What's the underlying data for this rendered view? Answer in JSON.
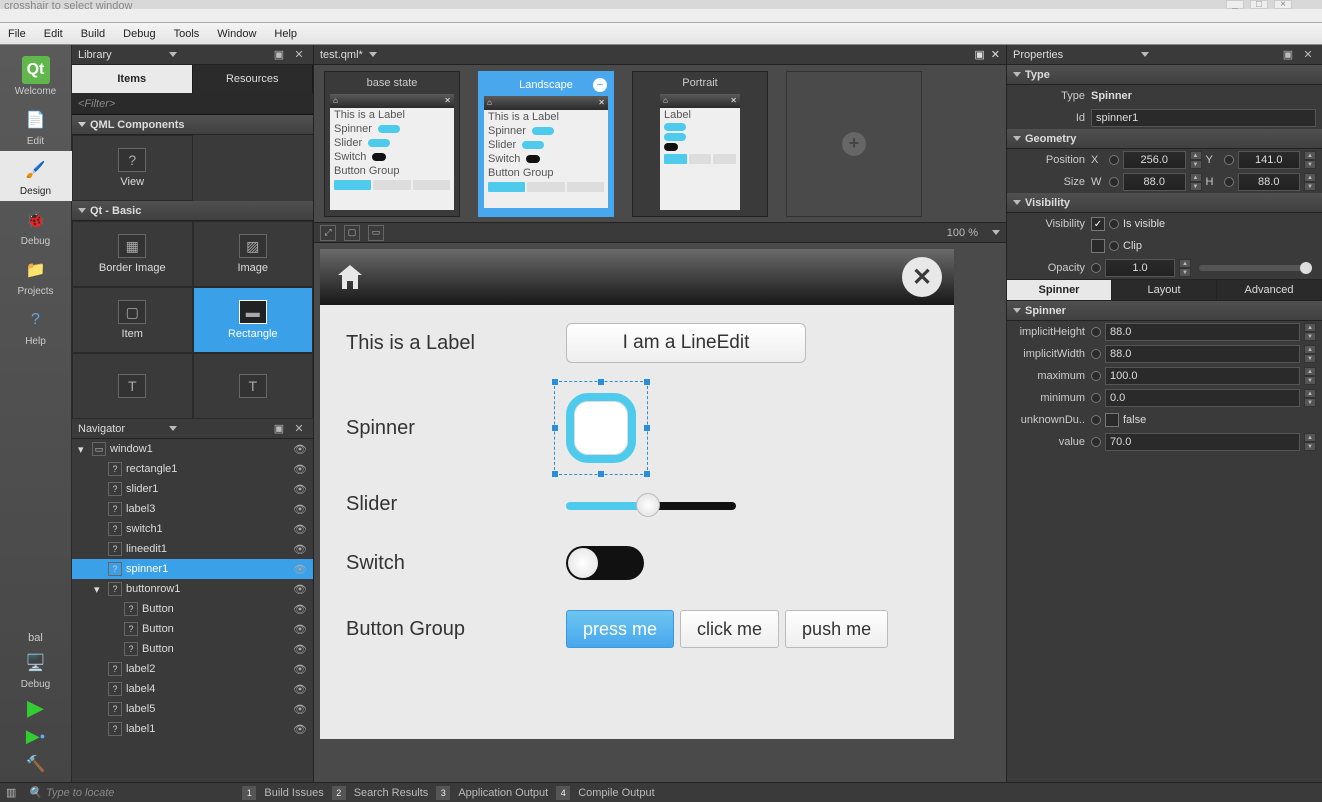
{
  "topcrop": "crosshair to select window",
  "menu": [
    "File",
    "Edit",
    "Build",
    "Debug",
    "Tools",
    "Window",
    "Help"
  ],
  "modes": [
    {
      "label": "Welcome",
      "iconColor": "#62b74c"
    },
    {
      "label": "Edit"
    },
    {
      "label": "Design",
      "active": true
    },
    {
      "label": "Debug"
    },
    {
      "label": "Projects"
    },
    {
      "label": "Help"
    }
  ],
  "bottomLabel": "bal",
  "bottomDebug": "Debug",
  "leftpanel": {
    "libraryTitle": "Library",
    "tabs": [
      "Items",
      "Resources"
    ],
    "filterPlaceholder": "<Filter>",
    "section1": "QML Components",
    "section1Item": "View",
    "section2": "Qt - Basic",
    "items": [
      {
        "label": "Border Image"
      },
      {
        "label": "Image"
      },
      {
        "label": "Item"
      },
      {
        "label": "Rectangle",
        "selected": true
      }
    ],
    "navigatorTitle": "Navigator",
    "tree": [
      {
        "label": "window1",
        "depth": 0,
        "expand": "▾"
      },
      {
        "label": "rectangle1",
        "depth": 1
      },
      {
        "label": "slider1",
        "depth": 1
      },
      {
        "label": "label3",
        "depth": 1
      },
      {
        "label": "switch1",
        "depth": 1
      },
      {
        "label": "lineedit1",
        "depth": 1
      },
      {
        "label": "spinner1",
        "depth": 1,
        "selected": true
      },
      {
        "label": "buttonrow1",
        "depth": 1,
        "expand": "▾"
      },
      {
        "label": "Button",
        "depth": 2
      },
      {
        "label": "Button",
        "depth": 2
      },
      {
        "label": "Button",
        "depth": 2
      },
      {
        "label": "label2",
        "depth": 1
      },
      {
        "label": "label4",
        "depth": 1
      },
      {
        "label": "label5",
        "depth": 1
      },
      {
        "label": "label1",
        "depth": 1
      }
    ]
  },
  "center": {
    "filename": "test.qml*",
    "states": [
      {
        "label": "base state"
      },
      {
        "label": "Landscape",
        "selected": true
      },
      {
        "label": "Portrait"
      }
    ],
    "zoom": "100 %",
    "labelLabel": "This is a Label",
    "lineedit": "I am a LineEdit",
    "spinnerLabel": "Spinner",
    "sliderLabel": "Slider",
    "switchLabel": "Switch",
    "btnGroupLabel": "Button Group",
    "buttons": [
      "press me",
      "click me",
      "push me"
    ]
  },
  "props": {
    "title": "Properties",
    "typeHdr": "Type",
    "typeLabel": "Type",
    "typeValue": "Spinner",
    "idLabel": "Id",
    "idValue": "spinner1",
    "geomHdr": "Geometry",
    "posLabel": "Position",
    "x": "256.0",
    "y": "141.0",
    "sizeLabel": "Size",
    "w": "88.0",
    "h": "88.0",
    "visHdr": "Visibility",
    "visLabel": "Visibility",
    "isVisible": "Is visible",
    "clip": "Clip",
    "opacityLabel": "Opacity",
    "opacity": "1.0",
    "subtabs": [
      "Spinner",
      "Layout",
      "Advanced"
    ],
    "spinnerHdr": "Spinner",
    "fields": [
      {
        "label": "implicitHeight",
        "value": "88.0"
      },
      {
        "label": "implicitWidth",
        "value": "88.0"
      },
      {
        "label": "maximum",
        "value": "100.0"
      },
      {
        "label": "minimum",
        "value": "0.0"
      },
      {
        "label": "unknownDu..",
        "value": "false",
        "checkbox": true
      },
      {
        "label": "value",
        "value": "70.0"
      }
    ]
  },
  "status": {
    "locate": "Type to locate",
    "items": [
      "Build Issues",
      "Search Results",
      "Application Output",
      "Compile Output"
    ]
  }
}
